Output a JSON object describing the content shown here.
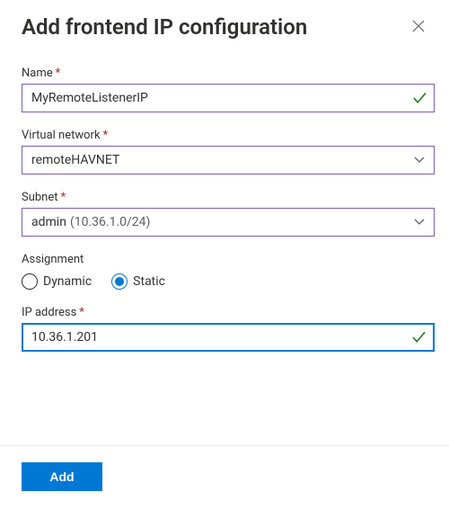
{
  "header": {
    "title": "Add frontend IP configuration"
  },
  "form": {
    "name": {
      "label": "Name",
      "required_marker": "*",
      "value": "MyRemoteListenerIP"
    },
    "vnet": {
      "label": "Virtual network",
      "required_marker": "*",
      "value": "remoteHAVNET"
    },
    "subnet": {
      "label": "Subnet",
      "required_marker": "*",
      "value": "admin",
      "value_detail": "(10.36.1.0/24)"
    },
    "assignment": {
      "label": "Assignment",
      "options": {
        "dynamic": "Dynamic",
        "static": "Static"
      },
      "selected": "static"
    },
    "ip": {
      "label": "IP address",
      "required_marker": "*",
      "value": "10.36.1.201"
    }
  },
  "footer": {
    "add_label": "Add"
  },
  "colors": {
    "primary": "#0078d4",
    "success": "#107c10",
    "required": "#a4262c",
    "field_border_valid": "#7c5fb3"
  }
}
